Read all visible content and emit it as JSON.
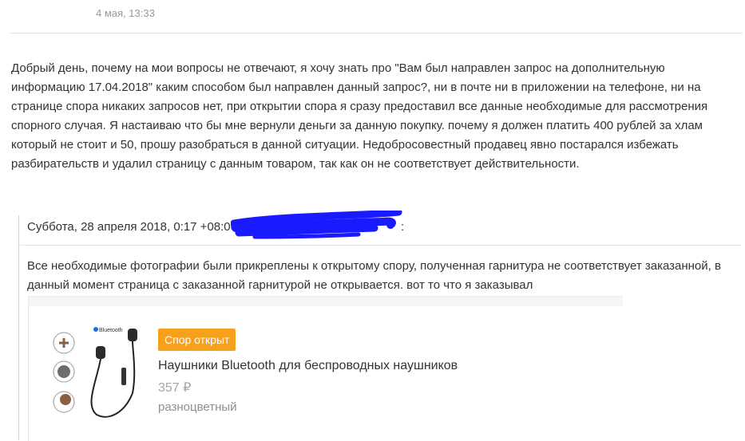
{
  "message": {
    "date": "4 мая, 13:33",
    "text": "Добрый день, почему на мои вопросы не отвечают, я хочу знать про \"Вам был направлен запрос на дополнительную информацию 17.04.2018\" каким способом был направлен данный запрос?, ни в почте ни в приложении на телефоне, ни на странице спора никаких запросов нет, при открытии спора я сразу предоставил все данные необходимые для рассмотрения спорного случая. Я настаиваю что бы мне вернули деньги за данную покупку. почему я должен платить 400 рублей за хлам который не стоит и 50, прошу разобраться в данной ситуации. Недобросовестный продавец явно постарался избежать разбирательств и удалил страницу с данным товаром, так как он не соответствует действительности."
  },
  "quote": {
    "header_prefix": "Суббота, 28 апреля 2018, 0:17 +08:00",
    "header_suffix": ":",
    "text": "Все необходимые фотографии были прикреплены к открытому спору, полученная гарнитура не соответствует заказанной, в данный момент страница с заказанной гарнитурой не открывается. вот то что я заказывал"
  },
  "product": {
    "badge": "Спор открыт",
    "name": "Наушники Bluetooth для беспроводных наушников",
    "price": "357 ₽",
    "variant": "разноцветный",
    "image_brand": "Bluetooth",
    "badge_color": "#f7a01c",
    "redaction_color": "#1a1aff"
  }
}
